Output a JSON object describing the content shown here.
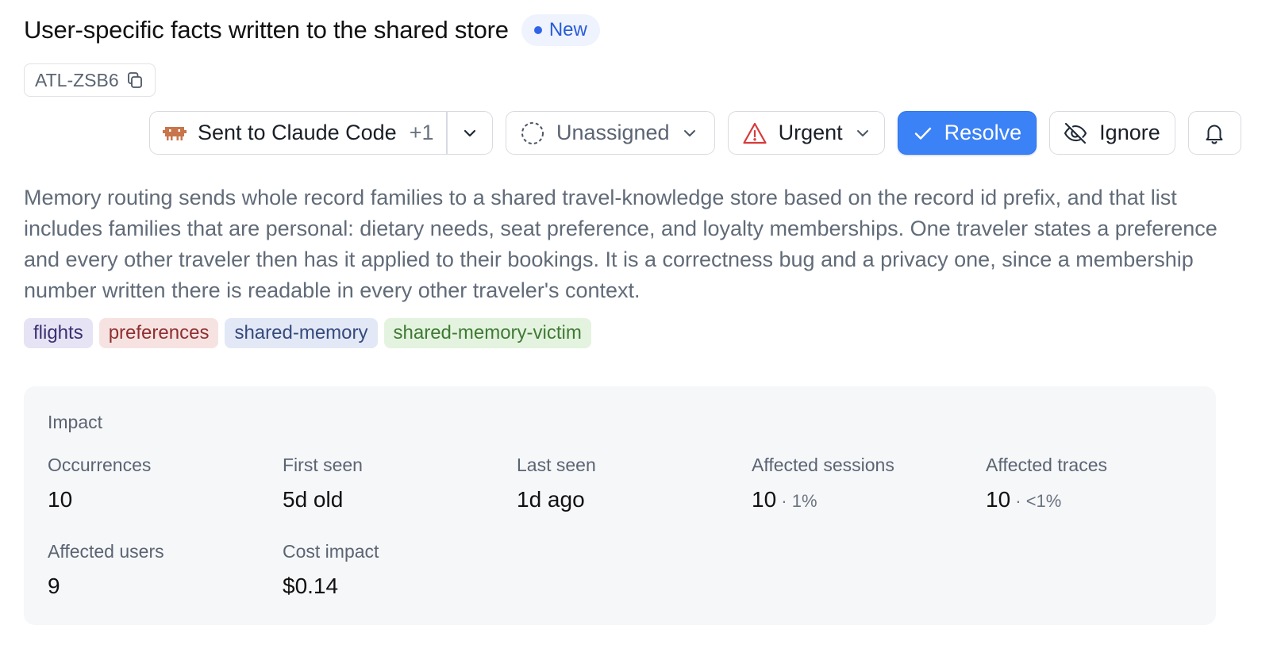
{
  "header": {
    "title": "User-specific facts written to the shared store",
    "status_badge": "New",
    "issue_id": "ATL-ZSB6"
  },
  "toolbar": {
    "integration_label": "Sent to Claude Code",
    "integration_extra": "+1",
    "assignee_label": "Unassigned",
    "priority_label": "Urgent",
    "resolve_label": "Resolve",
    "ignore_label": "Ignore"
  },
  "description": "Memory routing sends whole record families to a shared travel-knowledge store based on the record id prefix, and that list includes families that are personal: dietary needs, seat preference, and loyalty memberships. One traveler states a preference and every other traveler then has it applied to their bookings. It is a correctness bug and a privacy one, since a membership number written there is readable in every other traveler's context.",
  "tags": [
    {
      "label": "flights",
      "bg": "#e6e3f5",
      "fg": "#3a3172"
    },
    {
      "label": "preferences",
      "bg": "#f7e2e2",
      "fg": "#8e3030"
    },
    {
      "label": "shared-memory",
      "bg": "#e2e8f5",
      "fg": "#364a7d"
    },
    {
      "label": "shared-memory-victim",
      "bg": "#e4f3df",
      "fg": "#3f7a35"
    }
  ],
  "impact": {
    "title": "Impact",
    "metrics": [
      {
        "label": "Occurrences",
        "value": "10",
        "sub": ""
      },
      {
        "label": "First seen",
        "value": "5d old",
        "sub": ""
      },
      {
        "label": "Last seen",
        "value": "1d ago",
        "sub": ""
      },
      {
        "label": "Affected sessions",
        "value": "10",
        "sub": " · 1%"
      },
      {
        "label": "Affected traces",
        "value": "10",
        "sub": " · <1%"
      },
      {
        "label": "Affected users",
        "value": "9",
        "sub": ""
      },
      {
        "label": "Cost impact",
        "value": "$0.14",
        "sub": ""
      }
    ]
  },
  "colors": {
    "accent": "#3b82f6",
    "badge_bg": "#eef3fe",
    "badge_text": "#2a5bd7",
    "urgent": "#d73a3a",
    "integration_icon": "#c8754c"
  },
  "icons": {
    "copy": "copy-icon",
    "integration": "claude-code-icon",
    "assignee": "dashed-circle-icon",
    "priority": "warning-triangle-icon",
    "resolve": "check-icon",
    "ignore": "eye-off-icon",
    "notify": "bell-icon",
    "dropdown": "chevron-down-icon"
  }
}
